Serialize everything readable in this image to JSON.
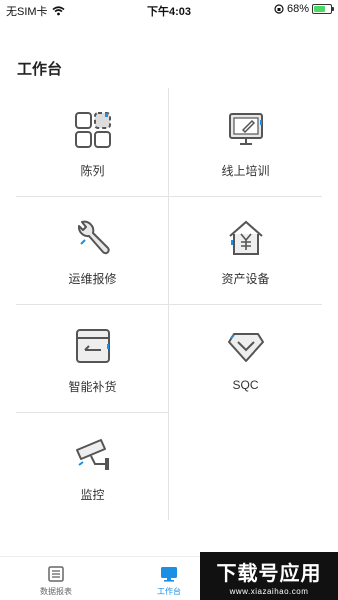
{
  "status_bar": {
    "carrier": "无SIM卡",
    "time": "下午4:03",
    "battery": "68%",
    "battery_level": 0.68
  },
  "page": {
    "title": "工作台"
  },
  "grid_items": [
    {
      "label": "陈列",
      "icon": "display-grid-icon"
    },
    {
      "label": "线上培训",
      "icon": "online-training-icon"
    },
    {
      "label": "运维报修",
      "icon": "maintenance-wrench-icon"
    },
    {
      "label": "资产设备",
      "icon": "asset-house-icon"
    },
    {
      "label": "智能补货",
      "icon": "smart-restock-icon"
    },
    {
      "label": "SQC",
      "icon": "sqc-diamond-icon"
    },
    {
      "label": "监控",
      "icon": "surveillance-camera-icon"
    }
  ],
  "tabs": [
    {
      "label": "数据报表",
      "icon": "report-icon",
      "active": false
    },
    {
      "label": "工作台",
      "icon": "workbench-icon",
      "active": true
    }
  ],
  "watermark": {
    "big": "下载号应用",
    "small": "www.xiazaihao.com"
  },
  "colors": {
    "accent": "#1a8fe3",
    "icon_gray": "#555555",
    "divider": "#e3e3e3"
  }
}
